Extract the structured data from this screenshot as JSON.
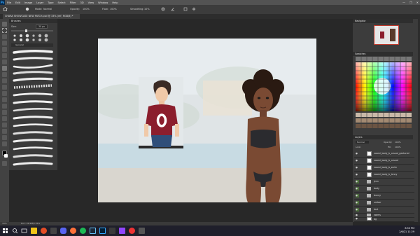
{
  "app": {
    "logo": "Ps",
    "menu": [
      "File",
      "Edit",
      "Image",
      "Layer",
      "Type",
      "Select",
      "Filter",
      "3D",
      "View",
      "Window",
      "Help"
    ],
    "window_controls": [
      "—",
      "❐",
      "✕"
    ]
  },
  "options_bar": {
    "mode_label": "Mode:",
    "mode_value": "Normal",
    "opacity_label": "Opacity:",
    "opacity_value": "100%",
    "flow_label": "Flow:",
    "flow_value": "100%",
    "smoothing_label": "Smoothing:",
    "smoothing_value": "10%"
  },
  "document_tab": {
    "title": "CHARA SHOWCASE NEW PATCH.psd @ 33% (ref, RGB/8) *"
  },
  "brushes_panel": {
    "title": "Brushes",
    "size_label": "Size:",
    "size_value": "30 px",
    "group_name": "General"
  },
  "navigator": {
    "title": "Navigator"
  },
  "swatches": {
    "title": "Swatches"
  },
  "layers": {
    "title": "Layers",
    "blend_mode": "Normal",
    "opacity_label": "Opacity:",
    "opacity_value": "100%",
    "lock_label": "Lock:",
    "fill_label": "Fill:",
    "fill_value": "100%",
    "items": [
      {
        "name": "naomi_body_b_casual_gestured",
        "type": "layer"
      },
      {
        "name": "naomi_body_b_casual",
        "type": "layer"
      },
      {
        "name": "naomi_body_b_swim",
        "type": "layer"
      },
      {
        "name": "naomi_body_b_lenny",
        "type": "layer"
      },
      {
        "name": "jenn",
        "type": "folder"
      },
      {
        "name": "body",
        "type": "folder"
      },
      {
        "name": "bunny",
        "type": "folder"
      },
      {
        "name": "umbar",
        "type": "folder"
      },
      {
        "name": "text",
        "type": "folder"
      },
      {
        "name": "swims",
        "type": "folder"
      },
      {
        "name": "bg",
        "type": "layer"
      }
    ]
  },
  "status": {
    "zoom": "33%",
    "doc_info": "Doc: 24.9M/1.51G"
  },
  "canvas_art": {
    "shirt_number": "0"
  },
  "taskbar": {
    "search_icon": "search-icon",
    "time": "8:50 PM",
    "date": "2/6/21 11:29"
  },
  "colors": {
    "accent": "#31a8ff",
    "shirt": "#8b1e2d",
    "bikini": "#2b2b2f",
    "skin": "#7a4a33"
  }
}
